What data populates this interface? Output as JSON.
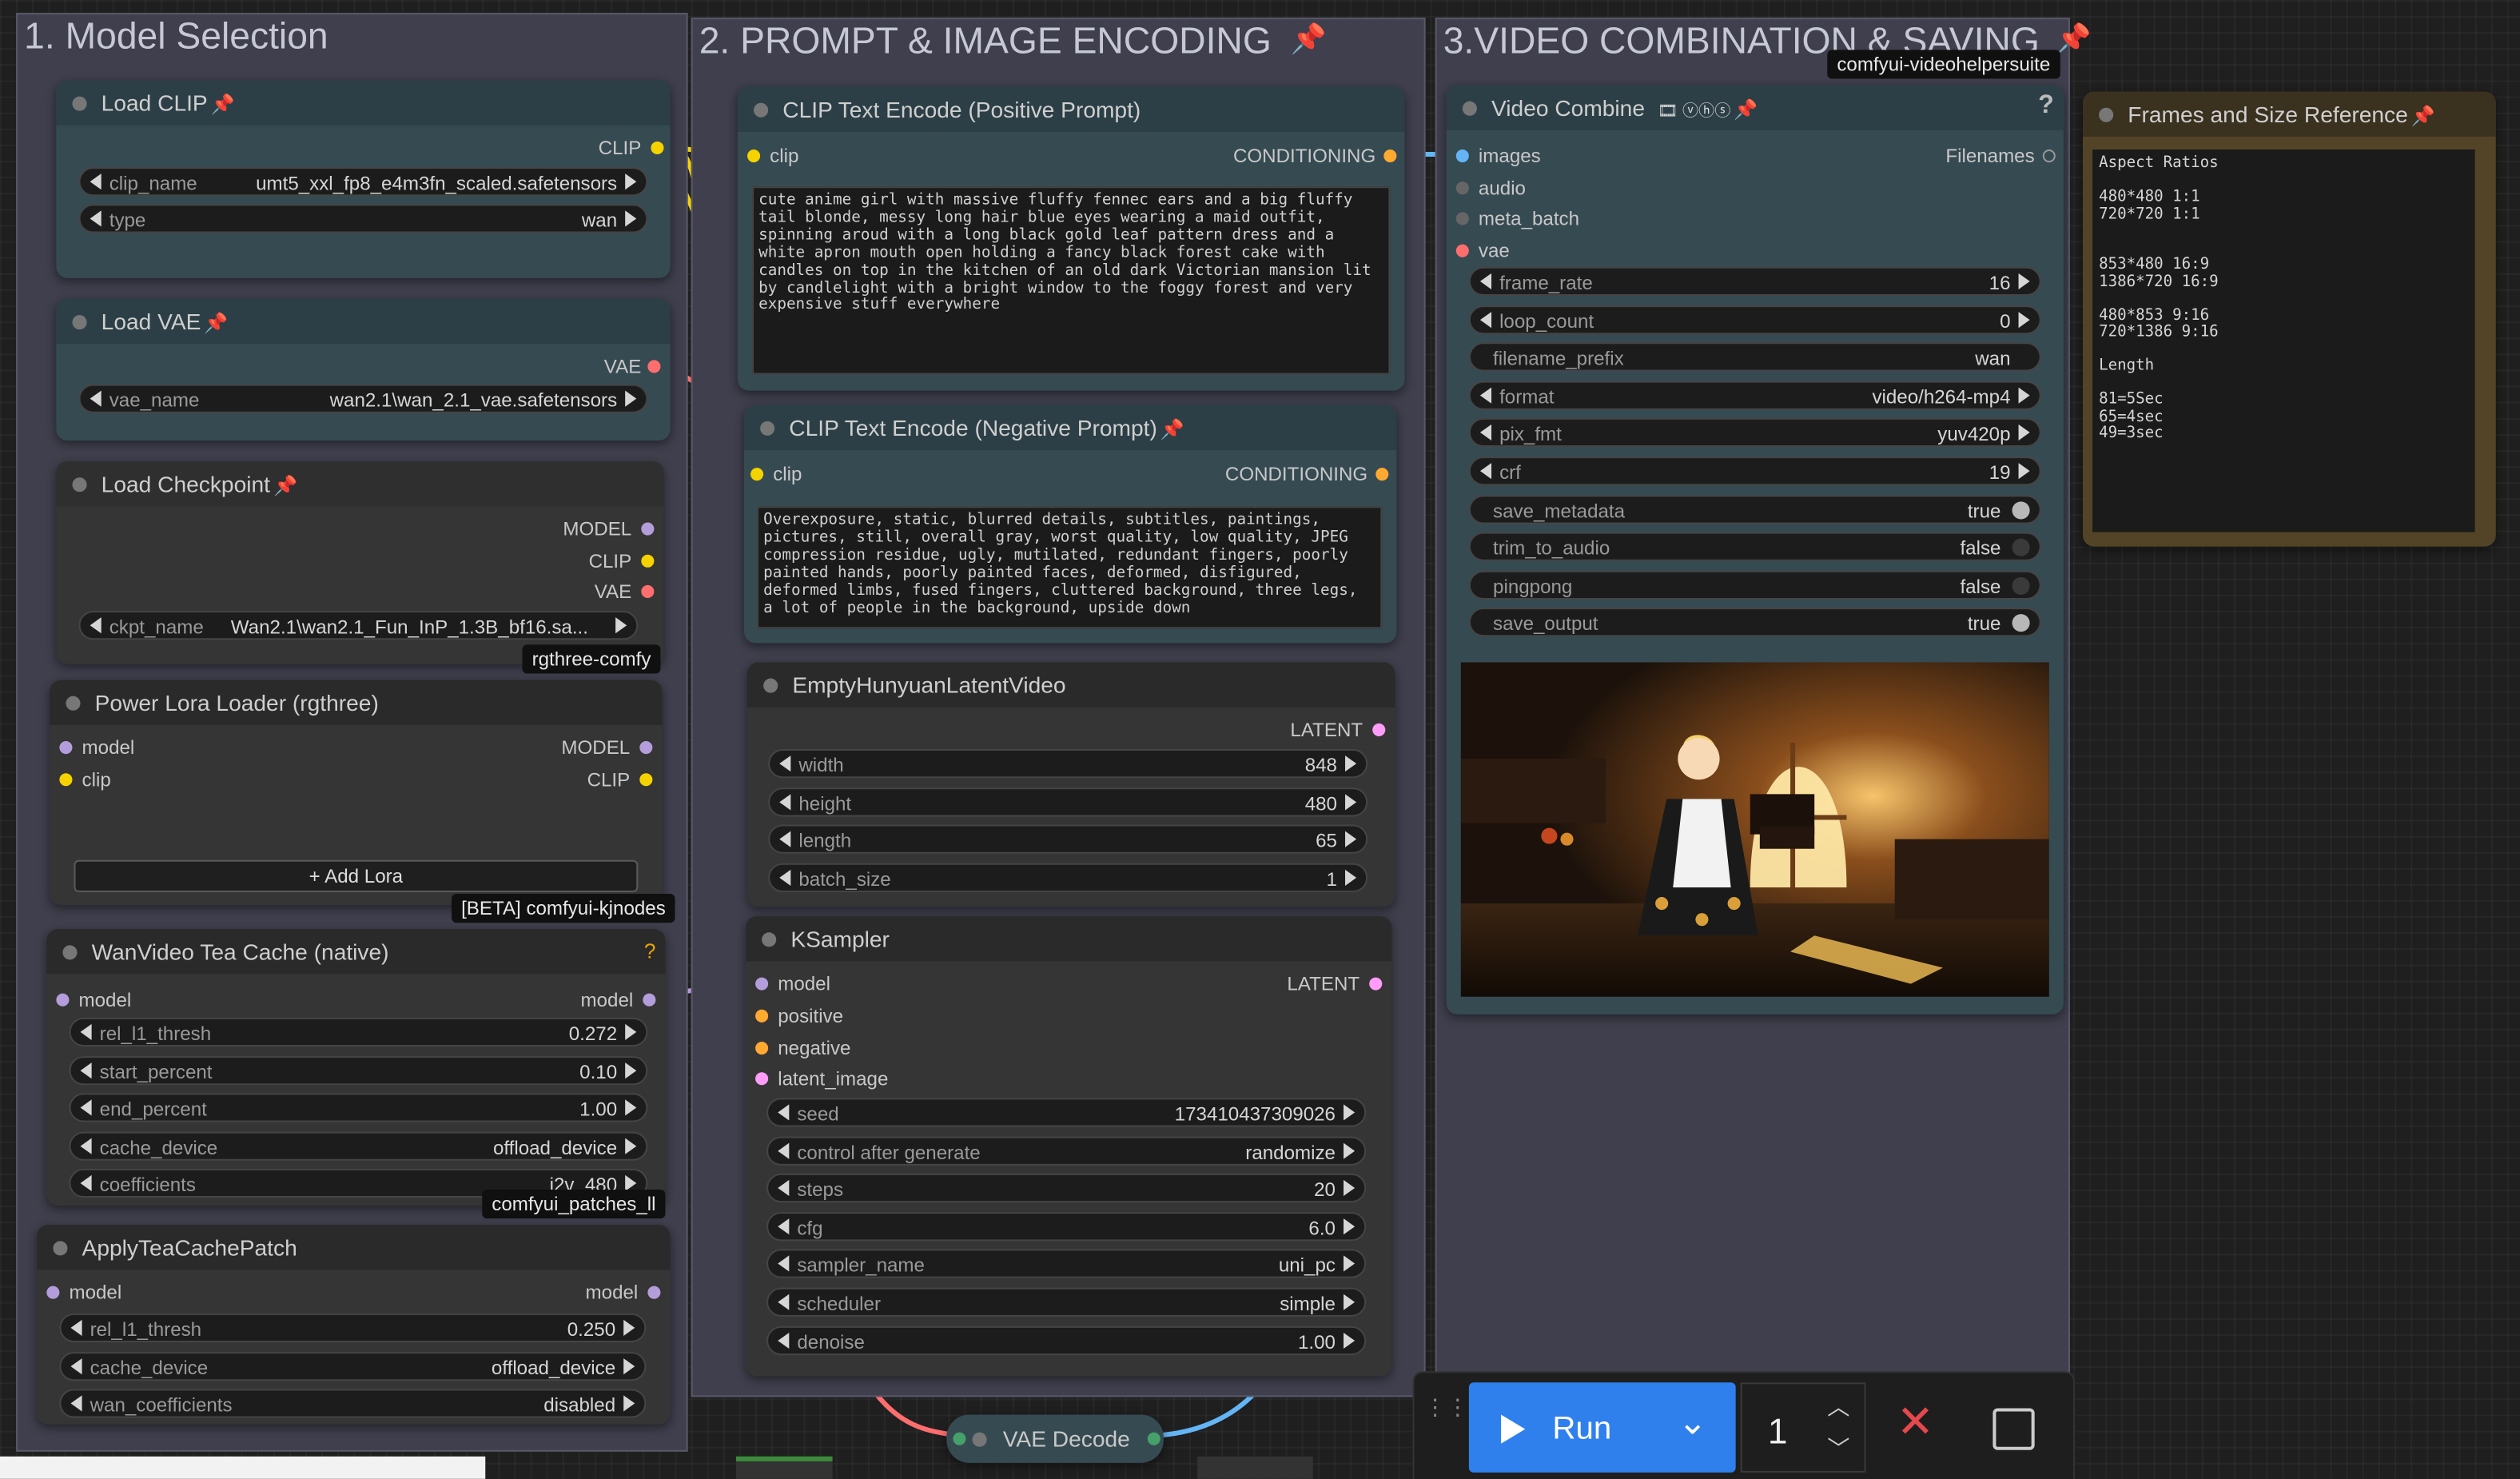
{
  "groups": {
    "model_selection": "1. Model Selection",
    "prompt_encoding": "2. PROMPT & IMAGE ENCODING",
    "video_saving": "3.VIDEO COMBINATION & SAVING"
  },
  "load_clip": {
    "title": "Load CLIP",
    "out_clip": "CLIP",
    "clip_name_label": "clip_name",
    "clip_name_value": "umt5_xxl_fp8_e4m3fn_scaled.safetensors",
    "type_label": "type",
    "type_value": "wan"
  },
  "load_vae": {
    "title": "Load VAE",
    "out_vae": "VAE",
    "vae_name_label": "vae_name",
    "vae_name_value": "wan2.1\\wan_2.1_vae.safetensors"
  },
  "load_checkpoint": {
    "title": "Load Checkpoint",
    "out_model": "MODEL",
    "out_clip": "CLIP",
    "out_vae": "VAE",
    "ckpt_label": "ckpt_name",
    "ckpt_value": "Wan2.1\\wan2.1_Fun_InP_1.3B_bf16.sa...",
    "badge": "rgthree-comfy"
  },
  "power_lora": {
    "title": "Power Lora Loader (rgthree)",
    "in_model": "model",
    "in_clip": "clip",
    "out_model": "MODEL",
    "out_clip": "CLIP",
    "add_lora": "+ Add Lora",
    "badge": "[BETA] comfyui-kjnodes"
  },
  "tea_cache": {
    "title": "WanVideo Tea Cache (native)",
    "help": "?",
    "in_model": "model",
    "out_model": "model",
    "widgets": [
      {
        "label": "rel_l1_thresh",
        "value": "0.272"
      },
      {
        "label": "start_percent",
        "value": "0.10"
      },
      {
        "label": "end_percent",
        "value": "1.00"
      },
      {
        "label": "cache_device",
        "value": "offload_device"
      },
      {
        "label": "coefficients",
        "value": "i2v_480"
      }
    ],
    "badge": "comfyui_patches_ll"
  },
  "apply_tea": {
    "title": "ApplyTeaCachePatch",
    "in_model": "model",
    "out_model": "model",
    "widgets": [
      {
        "label": "rel_l1_thresh",
        "value": "0.250"
      },
      {
        "label": "cache_device",
        "value": "offload_device"
      },
      {
        "label": "wan_coefficients",
        "value": "disabled"
      }
    ]
  },
  "clip_pos": {
    "title": "CLIP Text Encode (Positive Prompt)",
    "in_clip": "clip",
    "out": "CONDITIONING",
    "text": "cute anime girl with massive fluffy fennec ears and a big fluffy tail blonde, messy long hair blue eyes wearing a maid outfit, spinning aroud with a long black gold leaf pattern dress and a white apron mouth open holding a fancy black forest cake with candles on top in the kitchen of an old dark Victorian mansion lit by candlelight with a bright window to the foggy forest and very expensive stuff everywhere"
  },
  "clip_neg": {
    "title": "CLIP Text Encode (Negative Prompt)",
    "in_clip": "clip",
    "out": "CONDITIONING",
    "text": "Overexposure, static, blurred details, subtitles, paintings, pictures, still, overall gray, worst quality, low quality, JPEG compression residue, ugly, mutilated, redundant fingers, poorly painted hands, poorly painted faces, deformed, disfigured, deformed limbs, fused fingers, cluttered background, three legs, a lot of people in the background, upside down"
  },
  "empty_latent": {
    "title": "EmptyHunyuanLatentVideo",
    "out": "LATENT",
    "widgets": [
      {
        "label": "width",
        "value": "848"
      },
      {
        "label": "height",
        "value": "480"
      },
      {
        "label": "length",
        "value": "65"
      },
      {
        "label": "batch_size",
        "value": "1"
      }
    ]
  },
  "ksampler": {
    "title": "KSampler",
    "inputs": [
      "model",
      "positive",
      "negative",
      "latent_image"
    ],
    "out": "LATENT",
    "widgets": [
      {
        "label": "seed",
        "value": "173410437309026"
      },
      {
        "label": "control after generate",
        "value": "randomize"
      },
      {
        "label": "steps",
        "value": "20"
      },
      {
        "label": "cfg",
        "value": "6.0"
      },
      {
        "label": "sampler_name",
        "value": "uni_pc"
      },
      {
        "label": "scheduler",
        "value": "simple"
      },
      {
        "label": "denoise",
        "value": "1.00"
      }
    ]
  },
  "vae_decode": {
    "title": "VAE Decode"
  },
  "video_combine": {
    "title": "Video Combine",
    "badge_tag": "comfyui-videohelpersuite",
    "help": "?",
    "inputs": [
      "images",
      "audio",
      "meta_batch",
      "vae"
    ],
    "out": "Filenames",
    "widgets": [
      {
        "label": "frame_rate",
        "value": "16",
        "kind": "arrows"
      },
      {
        "label": "loop_count",
        "value": "0",
        "kind": "arrows"
      },
      {
        "label": "filename_prefix",
        "value": "wan",
        "kind": "text"
      },
      {
        "label": "format",
        "value": "video/h264-mp4",
        "kind": "arrows"
      },
      {
        "label": "pix_fmt",
        "value": "yuv420p",
        "kind": "arrows"
      },
      {
        "label": "crf",
        "value": "19",
        "kind": "arrows"
      },
      {
        "label": "save_metadata",
        "value": "true",
        "kind": "toggle"
      },
      {
        "label": "trim_to_audio",
        "value": "false",
        "kind": "toggle"
      },
      {
        "label": "pingpong",
        "value": "false",
        "kind": "toggle"
      },
      {
        "label": "save_output",
        "value": "true",
        "kind": "toggle"
      }
    ]
  },
  "frames_ref": {
    "title": "Frames and Size Reference",
    "text": "Aspect Ratios\n\n480*480 1:1\n720*720 1:1\n\n\n853*480 16:9\n1386*720 16:9\n\n480*853 9:16\n720*1386 9:16\n\nLength\n\n81=5Sec\n65=4sec\n49=3sec"
  },
  "run_bar": {
    "run_label": "Run",
    "queue_count": "1"
  },
  "colors": {
    "clip": "#f5d300",
    "vae": "#ff6e6e",
    "model": "#b39ddb",
    "latent": "#ff9cf9",
    "conditioning": "#ffa931",
    "image": "#64b5f6",
    "run": "#2f80ed",
    "group_bg": "#3f3f4d",
    "node_teal": "#364a52"
  },
  "icons": [
    "pin-icon",
    "vhs-icons",
    "run-play-icon",
    "chevron-down-icon",
    "close-icon",
    "stop-icon",
    "drag-handle-icon"
  ]
}
